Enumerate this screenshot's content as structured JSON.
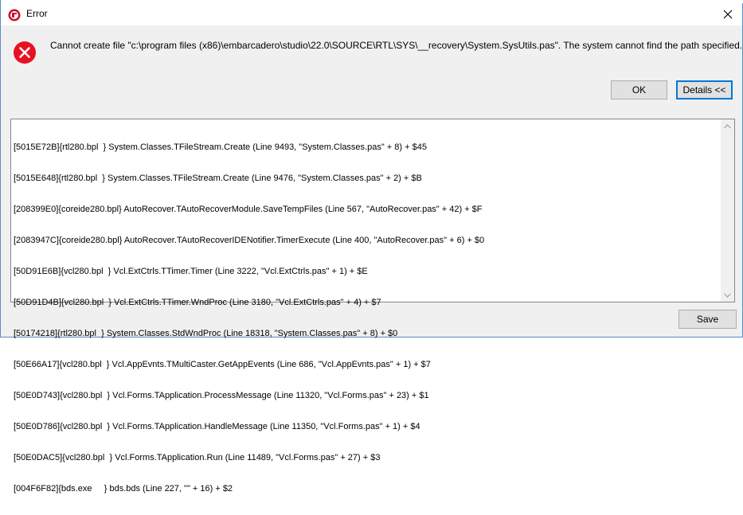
{
  "window": {
    "title": "Error",
    "app_icon": "delphi-logo-icon",
    "close_icon": "close-icon"
  },
  "message": {
    "icon": "error-icon",
    "text": "Cannot create file \"c:\\program files (x86)\\embarcadero\\studio\\22.0\\SOURCE\\RTL\\SYS\\__recovery\\System.SysUtils.pas\". The system cannot find the path specified."
  },
  "buttons": {
    "ok_label": "OK",
    "details_label": "Details <<",
    "save_label": "Save"
  },
  "log": {
    "lines": [
      "[5015E72B]{rtl280.bpl  } System.Classes.TFileStream.Create (Line 9493, \"System.Classes.pas\" + 8) + $45",
      "[5015E648]{rtl280.bpl  } System.Classes.TFileStream.Create (Line 9476, \"System.Classes.pas\" + 2) + $B",
      "[208399E0]{coreide280.bpl} AutoRecover.TAutoRecoverModule.SaveTempFiles (Line 567, \"AutoRecover.pas\" + 42) + $F",
      "[2083947C]{coreide280.bpl} AutoRecover.TAutoRecoverIDENotifier.TimerExecute (Line 400, \"AutoRecover.pas\" + 6) + $0",
      "[50D91E6B]{vcl280.bpl  } Vcl.ExtCtrls.TTimer.Timer (Line 3222, \"Vcl.ExtCtrls.pas\" + 1) + $E",
      "[50D91D4B]{vcl280.bpl  } Vcl.ExtCtrls.TTimer.WndProc (Line 3180, \"Vcl.ExtCtrls.pas\" + 4) + $7",
      "[50174218]{rtl280.bpl  } System.Classes.StdWndProc (Line 18318, \"System.Classes.pas\" + 8) + $0",
      "[50E66A17]{vcl280.bpl  } Vcl.AppEvnts.TMultiCaster.GetAppEvents (Line 686, \"Vcl.AppEvnts.pas\" + 1) + $7",
      "[50E0D743]{vcl280.bpl  } Vcl.Forms.TApplication.ProcessMessage (Line 11320, \"Vcl.Forms.pas\" + 23) + $1",
      "[50E0D786]{vcl280.bpl  } Vcl.Forms.TApplication.HandleMessage (Line 11350, \"Vcl.Forms.pas\" + 1) + $4",
      "[50E0DAC5]{vcl280.bpl  } Vcl.Forms.TApplication.Run (Line 11489, \"Vcl.Forms.pas\" + 27) + $3",
      "[004F6F82]{bds.exe     } bds.bds (Line 227, \"\" + 16) + $2"
    ]
  },
  "colors": {
    "error_red": "#e81123",
    "accent_blue": "#0078d7"
  }
}
